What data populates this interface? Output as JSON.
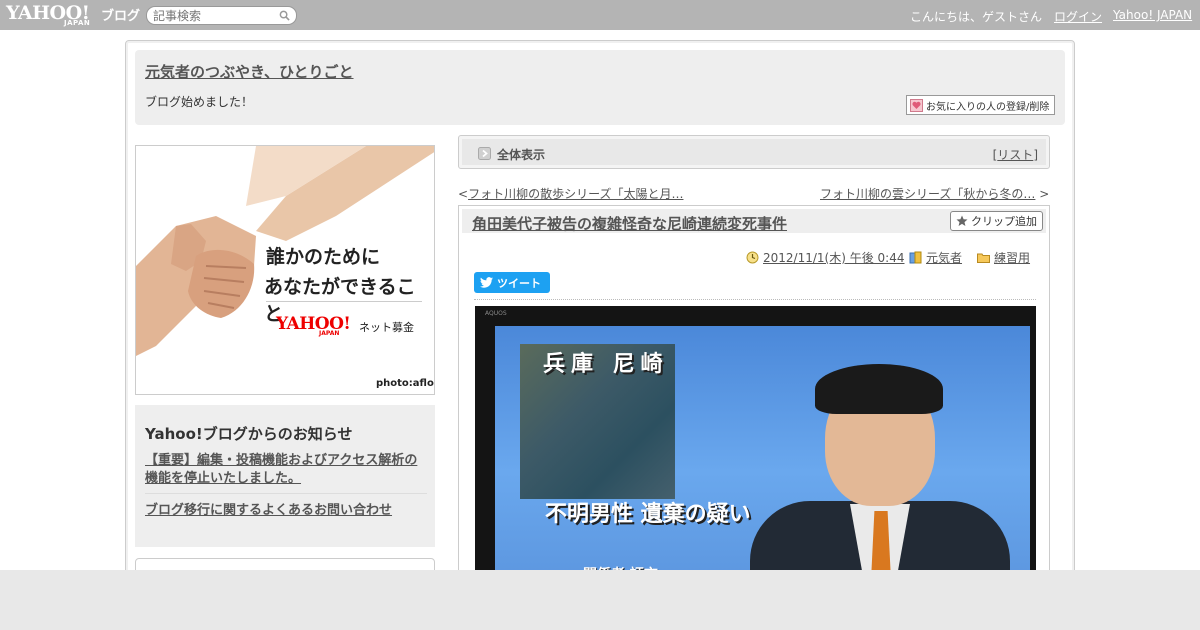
{
  "topbar": {
    "logo_yahoo": "YAHOO!",
    "logo_japan": "JAPAN",
    "logo_blog": "ブログ",
    "search_placeholder": "記事検索",
    "greeting": "こんにちは、ゲストさん",
    "login": "ログイン",
    "yahoo_japan": "Yahoo! JAPAN"
  },
  "blog": {
    "title": "元気者のつぶやき、ひとりごと",
    "description": "ブログ始めました！",
    "fav_button": "お気に入りの人の登録/削除"
  },
  "ad": {
    "line1": "誰かのために",
    "line2": "あなたができること",
    "yahoo": "YAHOO!",
    "japan": "JAPAN",
    "service": "ネット募金",
    "credit": "photo:aflo"
  },
  "notice": {
    "title": "Yahoo!ブログからのお知らせ",
    "items": [
      "【重要】編集・投稿機能およびアクセス解析の機能を停止いたしました。",
      "ブログ移行に関するよくあるお問い合わせ"
    ]
  },
  "view_bar": {
    "label": "全体表示",
    "list_open": "[",
    "list_link": "リスト",
    "list_close": "]"
  },
  "nav": {
    "prev_marker": "<",
    "prev": "フォト川柳の散歩シリーズ「太陽と月…",
    "next": "フォト川柳の雲シリーズ「秋から冬の…",
    "next_marker": ">"
  },
  "article": {
    "title": "角田美代子被告の複雑怪奇な尼崎連続変死事件",
    "clip_button": "クリップ追加",
    "date": "2012/11/1(木) 午後 0:44",
    "author": "元気者",
    "category": "練習用",
    "tweet": "ツイート",
    "photo_captions": {
      "place": "兵庫 尼崎",
      "headline": "不明男性 遺棄の疑い",
      "sub": "関係者 証言",
      "tv_brand": "AQUOS"
    }
  },
  "colors": {
    "topbar": "#b4b4b4",
    "tweet": "#1da1f2",
    "ad_brand": "#ee0000"
  }
}
